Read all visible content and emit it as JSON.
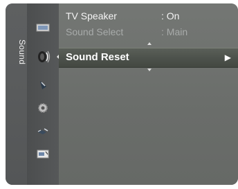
{
  "menu": {
    "category_label": "Sound",
    "icons": [
      "picture-icon",
      "sound-icon",
      "channel-icon",
      "setup-icon",
      "input-icon",
      "application-icon"
    ],
    "active_icon": "sound-icon"
  },
  "items": [
    {
      "label": "TV Speaker",
      "value": ": On",
      "state": "normal"
    },
    {
      "label": "Sound Select",
      "value": ": Main",
      "state": "disabled"
    }
  ],
  "selected": {
    "label": "Sound Reset",
    "arrow": "▶"
  }
}
